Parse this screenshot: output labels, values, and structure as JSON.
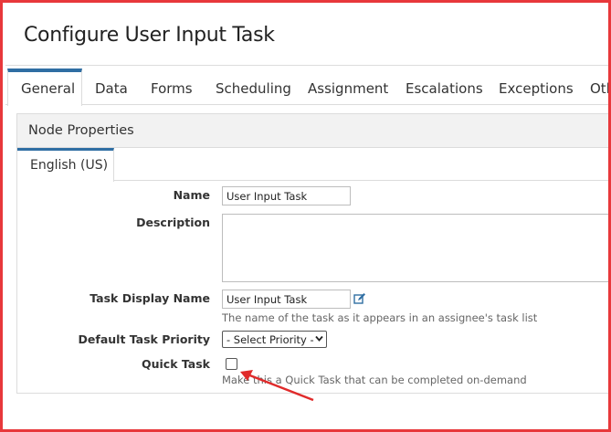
{
  "header": {
    "title": "Configure User Input Task"
  },
  "tabs": [
    {
      "label": "General",
      "active": true
    },
    {
      "label": "Data"
    },
    {
      "label": "Forms"
    },
    {
      "label": "Scheduling"
    },
    {
      "label": "Assignment"
    },
    {
      "label": "Escalations"
    },
    {
      "label": "Exceptions"
    },
    {
      "label": "Oth"
    }
  ],
  "panel": {
    "title": "Node Properties",
    "language_tab": "English (US)",
    "fields": {
      "name": {
        "label": "Name",
        "value": "User Input Task"
      },
      "description": {
        "label": "Description",
        "value": ""
      },
      "task_display_name": {
        "label": "Task Display Name",
        "value": "User Input Task",
        "hint": "The name of the task as it appears in an assignee's task list"
      },
      "default_task_priority": {
        "label": "Default Task Priority",
        "selected": "- Select Priority -"
      },
      "quick_task": {
        "label": "Quick Task",
        "checked": false,
        "hint": "Make this a Quick Task that can be completed on-demand"
      }
    }
  },
  "colors": {
    "accent": "#2f6ea3",
    "frame": "#e8383b",
    "arrow": "#e02b2b"
  },
  "icons": {
    "edit": "edit-icon",
    "dropdown": "chevron-down-icon"
  }
}
